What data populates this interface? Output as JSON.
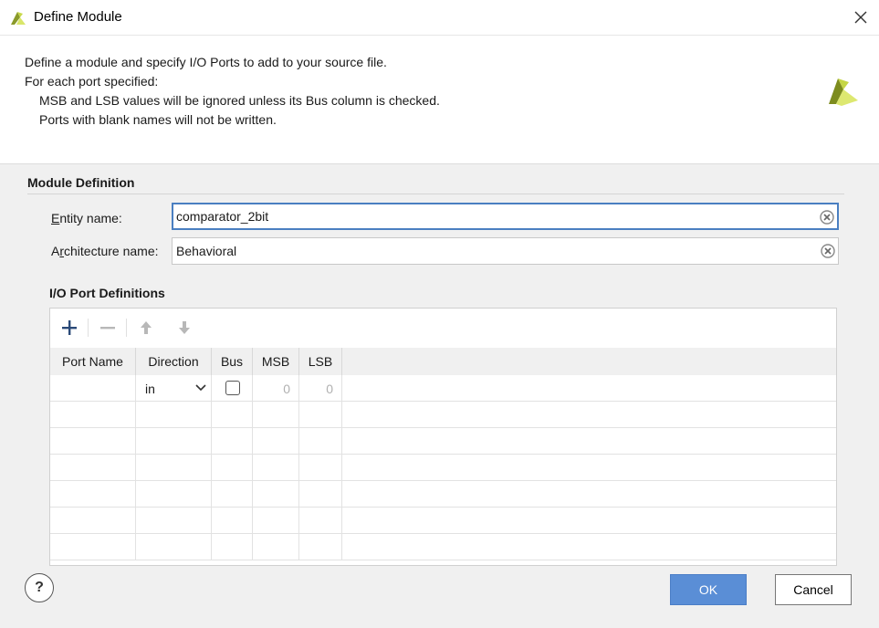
{
  "window": {
    "title": "Define Module"
  },
  "description": {
    "line1": "Define a module and specify I/O Ports to add to your source file.",
    "line2": "For each port specified:",
    "line3": "MSB and LSB values will be ignored unless its Bus column is checked.",
    "line4": "Ports with blank names will not be written."
  },
  "module_definition": {
    "title": "Module Definition",
    "entity_label_first": "E",
    "entity_label_rest": "ntity name:",
    "entity_value": "comparator_2bit",
    "arch_label_first": "A",
    "arch_label_mid": "r",
    "arch_label_rest": "chitecture name:",
    "arch_value": "Behavioral"
  },
  "io_ports": {
    "title": "I/O Port Definitions",
    "toolbar": [
      "add-icon",
      "remove-icon",
      "move-up-icon",
      "move-down-icon"
    ],
    "columns": [
      "Port Name",
      "Direction",
      "Bus",
      "MSB",
      "LSB"
    ],
    "rows": [
      {
        "port_name": "",
        "direction": "in",
        "bus": false,
        "msb": "0",
        "lsb": "0"
      }
    ]
  },
  "buttons": {
    "help": "?",
    "ok": "OK",
    "cancel": "Cancel"
  },
  "colors": {
    "accent": "#5a8ed6",
    "focus_border": "#4a7fc1",
    "logo": "#8a9a2a"
  }
}
